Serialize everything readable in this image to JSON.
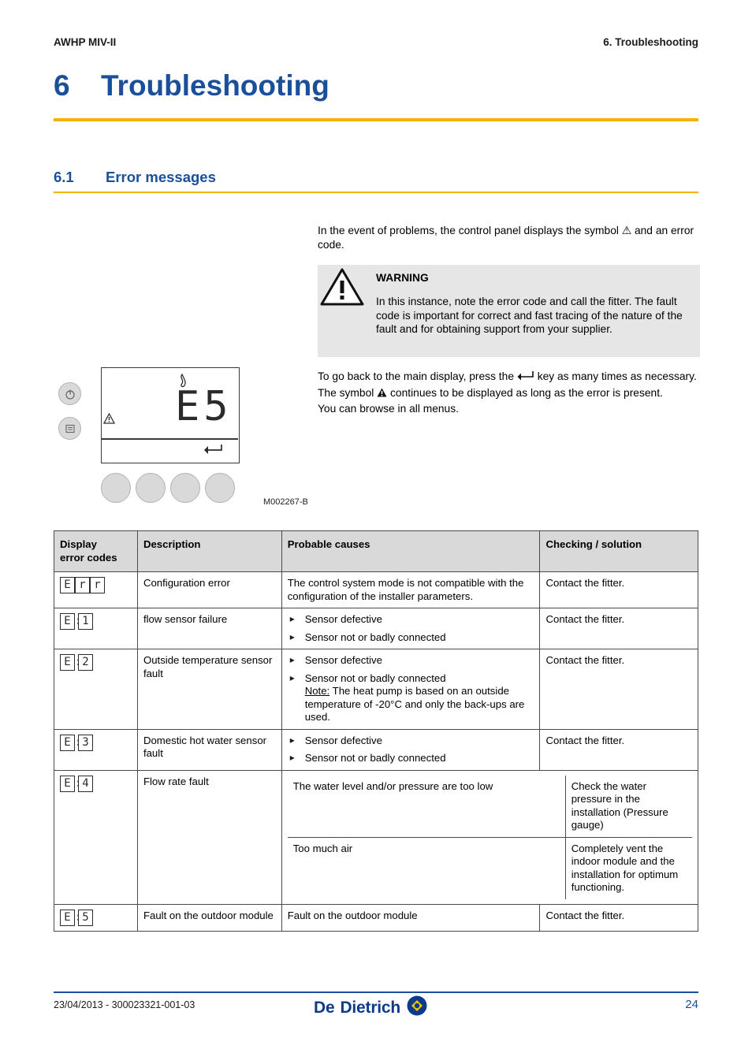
{
  "header": {
    "left": "AWHP MIV-II",
    "right": "6.  Troubleshooting"
  },
  "chapter": {
    "number": "6",
    "title": "Troubleshooting"
  },
  "section": {
    "number": "6.1",
    "title": "Error messages"
  },
  "intro": "In the event of problems, the control panel displays the symbol ⚠ and an error code.",
  "warning": {
    "title": "WARNING",
    "body": "In this instance, note the error code and call the fitter. The fault code is important for correct and fast tracing of the nature of the fault and for obtaining support from your supplier."
  },
  "after_warning": {
    "line1_a": "To go back to the main display, press the",
    "line1_b": "key as many times as necessary. The symbol",
    "line1_c": "continues to be displayed as long as the error is present.",
    "line2": "You can browse in all menus."
  },
  "illustration": {
    "display_code": "E5",
    "flame_icon": "flame-icon",
    "warning_icon": "warning-triangle-icon",
    "return_icon": "return-arrow-icon",
    "button_left_top": "standby-icon",
    "button_left_bottom": "menu-icon",
    "reference": "M002267-B"
  },
  "table": {
    "headers": {
      "code_line1": "Display",
      "code_line2": "error codes",
      "description": "Description",
      "causes": "Probable causes",
      "solution": "Checking / solution"
    },
    "rows": [
      {
        "code_chars": [
          "E",
          "r",
          "r"
        ],
        "code_separator": false,
        "description": "Configuration error",
        "causes_text": "The control system mode is not compatible with the configuration of the installer parameters.",
        "solution": "Contact the fitter."
      },
      {
        "code_chars": [
          "E",
          "1"
        ],
        "code_separator": true,
        "description": "flow sensor failure",
        "causes_bullets": [
          "Sensor defective",
          "Sensor not or badly connected"
        ],
        "solution": "Contact the fitter."
      },
      {
        "code_chars": [
          "E",
          "2"
        ],
        "code_separator": true,
        "description": "Outside temperature sensor fault",
        "causes_bullets": [
          "Sensor defective",
          "Sensor not or badly connected"
        ],
        "causes_note_label": "Note:",
        "causes_note_text": " The heat pump is based on an outside temperature of -20°C and only the back-ups are used.",
        "solution": "Contact the fitter."
      },
      {
        "code_chars": [
          "E",
          "3"
        ],
        "code_separator": true,
        "description": "Domestic hot water sensor fault",
        "causes_bullets": [
          "Sensor defective",
          "Sensor not or badly connected"
        ],
        "solution": "Contact the fitter."
      },
      {
        "code_chars": [
          "E",
          "4"
        ],
        "code_separator": true,
        "description": "Flow rate fault",
        "sub_rows": [
          {
            "cause": "The water level and/or pressure are too low",
            "solution": "Check the water pressure in the installation (Pressure gauge)"
          },
          {
            "cause": "Too much air",
            "solution": "Completely vent the indoor module and the installation for optimum functioning."
          }
        ]
      },
      {
        "code_chars": [
          "E",
          "5"
        ],
        "code_separator": true,
        "description": "Fault on the outdoor module",
        "causes_text": "Fault on the outdoor module",
        "solution": "Contact the fitter."
      }
    ]
  },
  "footer": {
    "left": "23/04/2013 - 300023321-001-03",
    "logo_de": "De",
    "logo_dietrich": "Dietrich",
    "page": "24"
  }
}
